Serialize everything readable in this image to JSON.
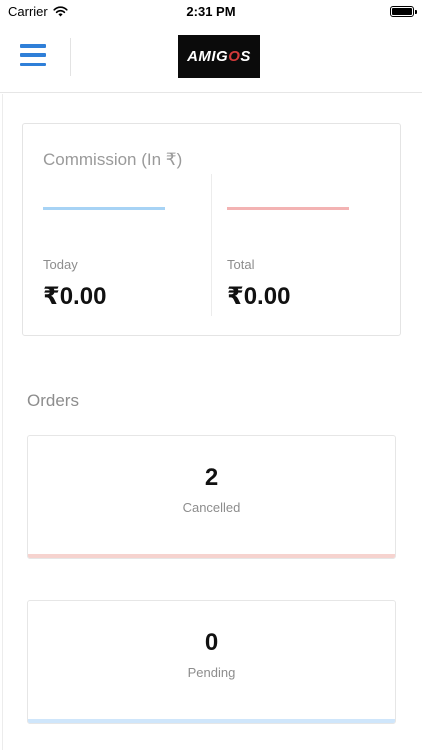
{
  "status_bar": {
    "carrier": "Carrier",
    "time": "2:31 PM"
  },
  "header": {
    "logo_text": "AMIGOS",
    "logo_part1": "AMIG",
    "logo_part2": "O",
    "logo_part3": "S"
  },
  "commission": {
    "title": "Commission (In ₹)",
    "today": {
      "label": "Today",
      "value": "₹0.00"
    },
    "total": {
      "label": "Total",
      "value": "₹0.00"
    },
    "colors": {
      "today_bar": "#a7d3f5",
      "total_bar": "#f3b3b3"
    }
  },
  "orders": {
    "heading": "Orders",
    "cards": [
      {
        "count": "2",
        "label": "Cancelled",
        "accent": "#f6d3cf"
      },
      {
        "count": "0",
        "label": "Pending",
        "accent": "#cfe6fb"
      }
    ]
  },
  "colors": {
    "accent_blue": "#2f7fd8"
  }
}
